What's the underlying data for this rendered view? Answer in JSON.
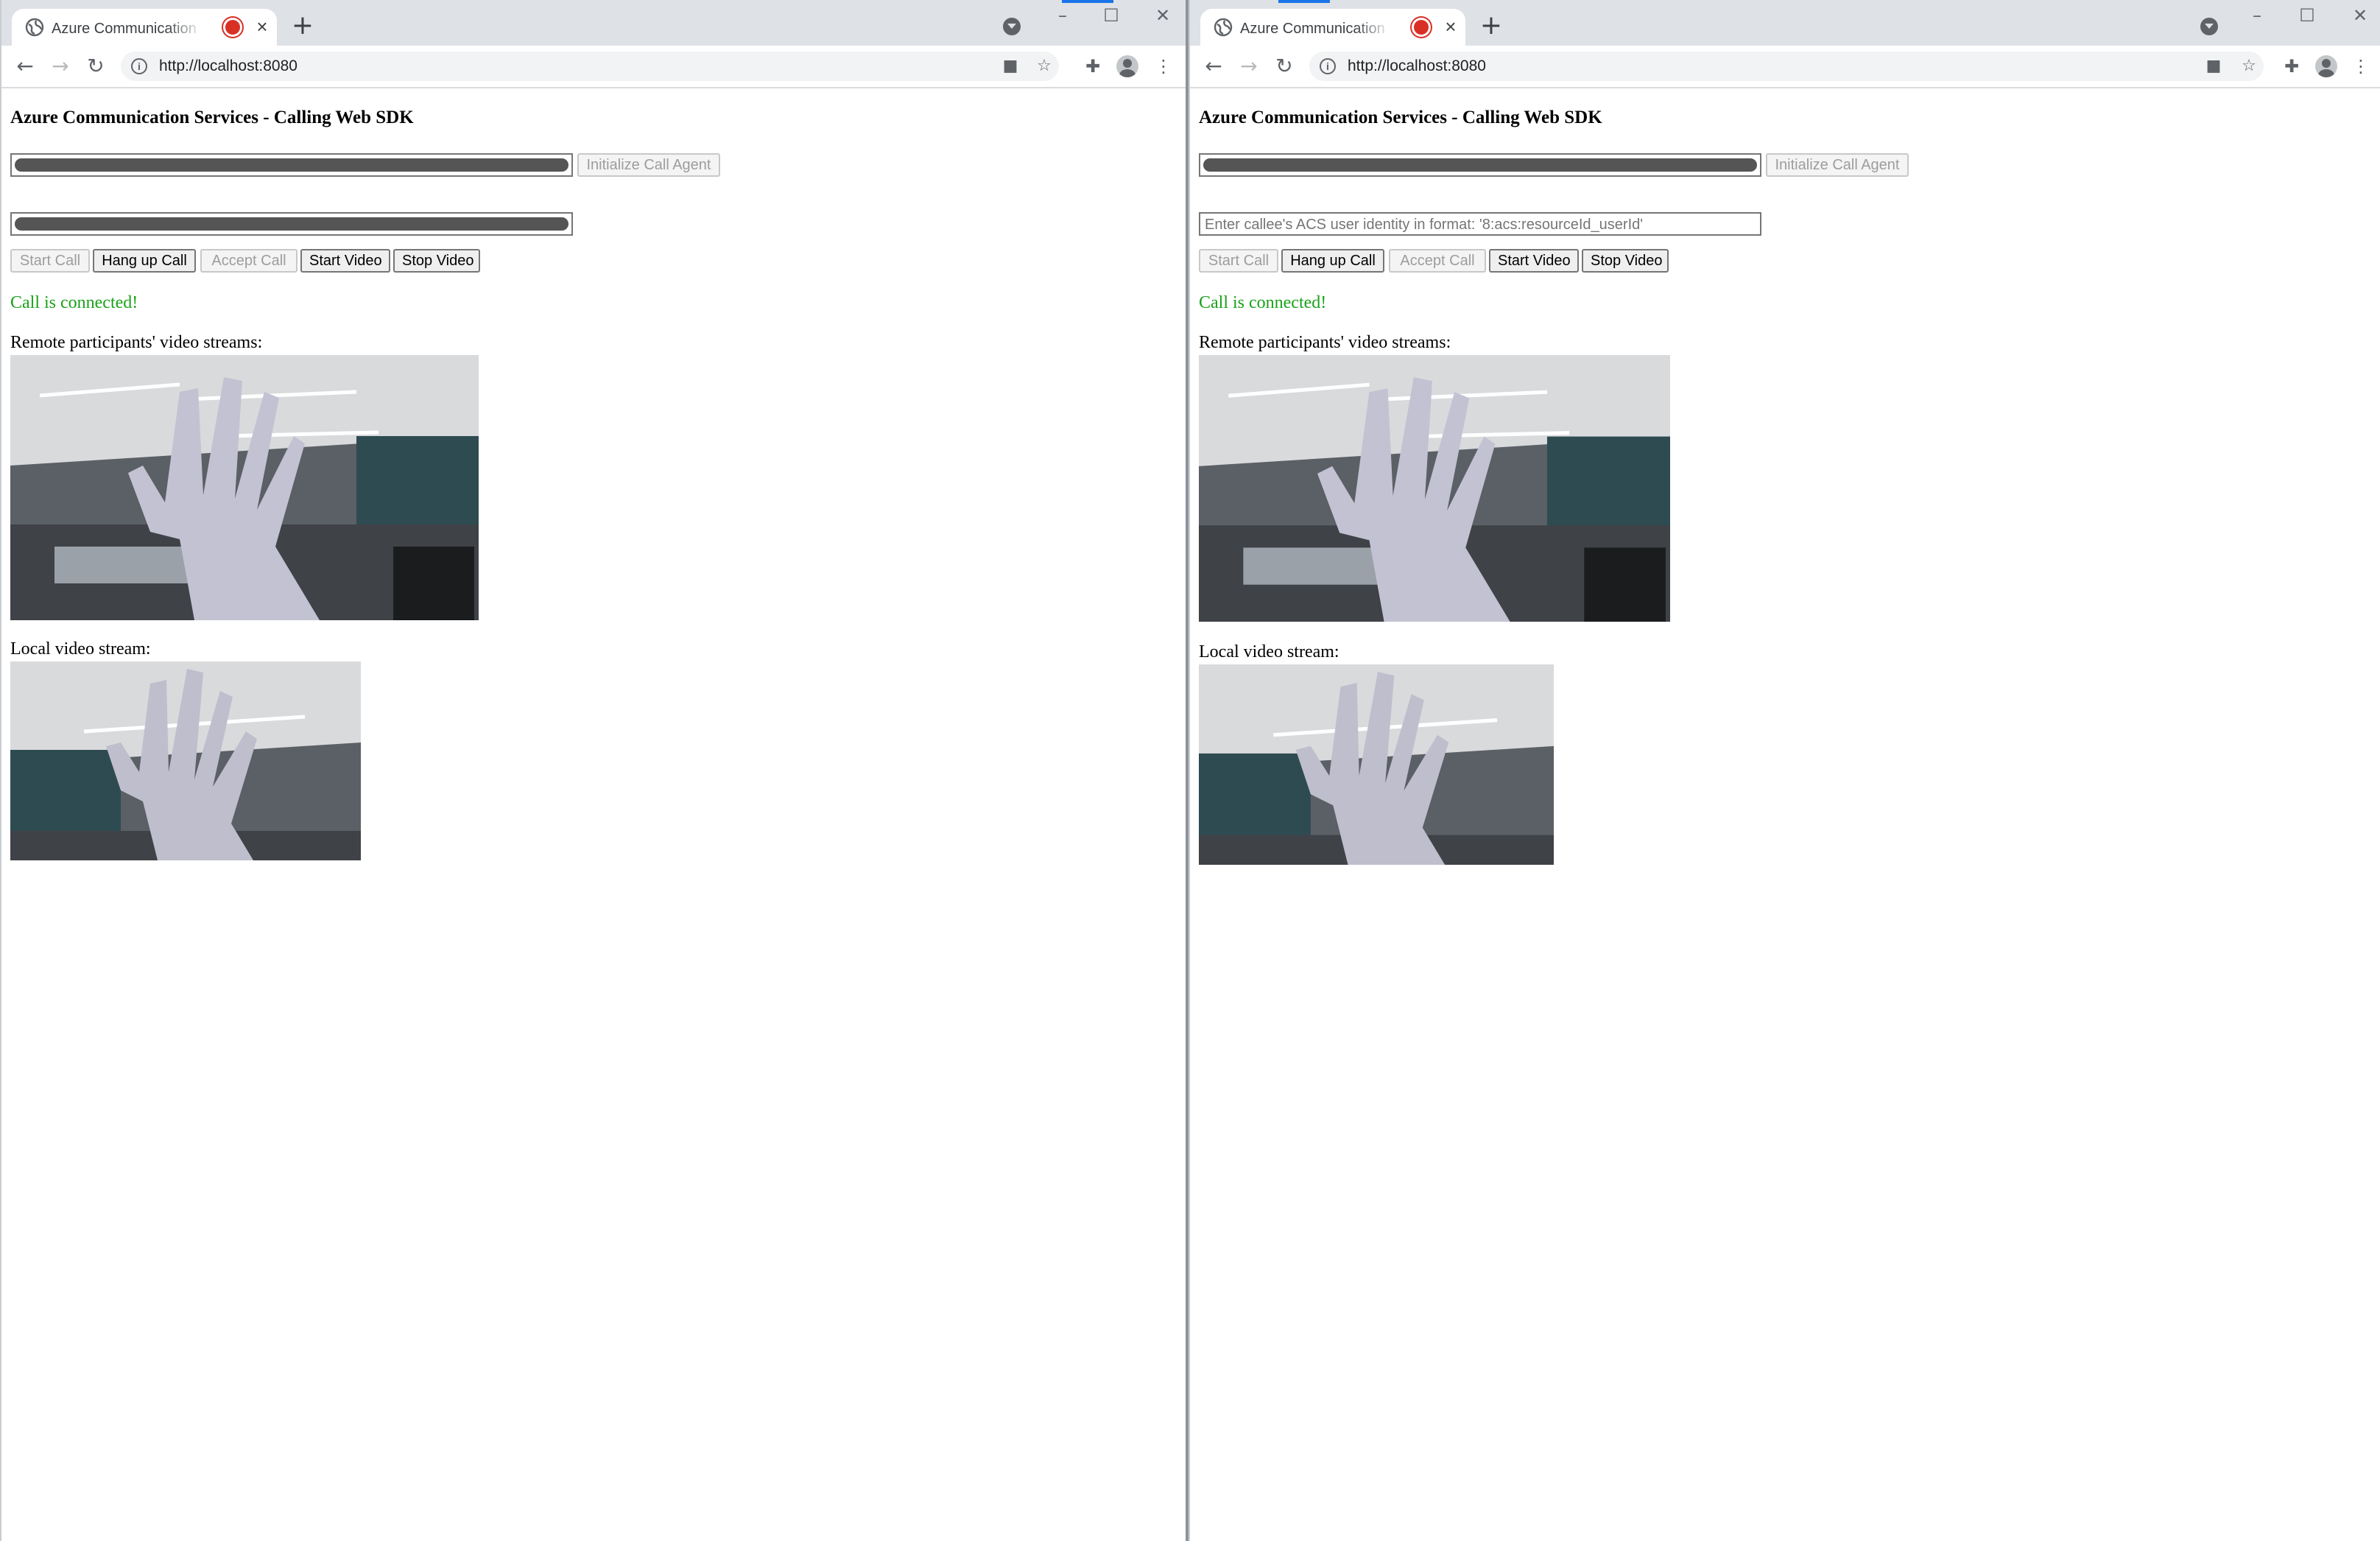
{
  "windows": [
    {
      "tab": {
        "title": "Azure Communication Servic"
      },
      "address": {
        "url": "http://localhost:8080"
      },
      "page": {
        "title": "Azure Communication Services - Calling Web SDK",
        "token_input": {
          "value_redacted": true
        },
        "init_button": {
          "label": "Initialize Call Agent",
          "enabled": false
        },
        "callee_input": {
          "value_redacted": true,
          "placeholder": "Enter callee's ACS user identity in format: '8:acs:resourceId_userId'"
        },
        "buttons": [
          {
            "label": "Start Call",
            "enabled": false
          },
          {
            "label": "Hang up Call",
            "enabled": true
          },
          {
            "label": "Accept Call",
            "enabled": false
          },
          {
            "label": "Start Video",
            "enabled": true
          },
          {
            "label": "Stop Video",
            "enabled": true
          }
        ],
        "status": "Call is connected!",
        "remote_label": "Remote participants' video streams:",
        "local_label": "Local video stream:"
      }
    },
    {
      "tab": {
        "title": "Azure Communication Servic"
      },
      "address": {
        "url": "http://localhost:8080"
      },
      "page": {
        "title": "Azure Communication Services - Calling Web SDK",
        "token_input": {
          "value_redacted": true
        },
        "init_button": {
          "label": "Initialize Call Agent",
          "enabled": false
        },
        "callee_input": {
          "value_redacted": false,
          "placeholder": "Enter callee's ACS user identity in format: '8:acs:resourceId_userId'"
        },
        "buttons": [
          {
            "label": "Start Call",
            "enabled": false
          },
          {
            "label": "Hang up Call",
            "enabled": true
          },
          {
            "label": "Accept Call",
            "enabled": false
          },
          {
            "label": "Start Video",
            "enabled": true
          },
          {
            "label": "Stop Video",
            "enabled": true
          }
        ],
        "status": "Call is connected!",
        "remote_label": "Remote participants' video streams:",
        "local_label": "Local video stream:"
      }
    }
  ],
  "colors": {
    "status": "#1aa11a",
    "recording": "#d93025",
    "tabstrip": "#dee1e6"
  },
  "icons": [
    "globe-icon",
    "recording-icon",
    "close-icon",
    "new-tab-icon",
    "tab-search-icon",
    "back-icon",
    "forward-icon",
    "reload-icon",
    "info-icon",
    "camera-icon",
    "star-icon",
    "extensions-icon",
    "profile-icon",
    "menu-icon"
  ]
}
